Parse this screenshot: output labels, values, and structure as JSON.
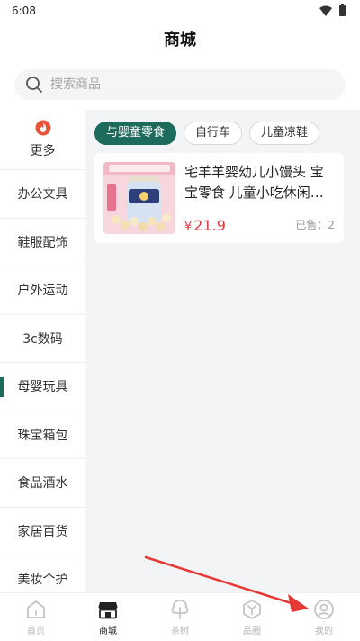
{
  "status_bar": {
    "time": "6:08"
  },
  "header": {
    "title": "商城"
  },
  "search": {
    "placeholder": "搜索商品"
  },
  "sidebar": {
    "items": [
      {
        "label": "更多",
        "icon": "fire-icon"
      },
      {
        "label": "办公文具"
      },
      {
        "label": "鞋服配饰"
      },
      {
        "label": "户外运动"
      },
      {
        "label": "3c数码"
      },
      {
        "label": "母婴玩具",
        "active": true
      },
      {
        "label": "珠宝箱包"
      },
      {
        "label": "食品酒水"
      },
      {
        "label": "家居百货"
      },
      {
        "label": "美妆个护"
      }
    ]
  },
  "subtabs": [
    {
      "label": "与婴童零食",
      "active": true
    },
    {
      "label": "自行车"
    },
    {
      "label": "儿童凉鞋"
    }
  ],
  "products": [
    {
      "title": "宅羊羊婴幼儿小馒头 宝宝零食 儿童小吃休闲…",
      "price_symbol": "¥",
      "price": "21.9",
      "sold": "已售：2"
    }
  ],
  "tabbar": {
    "items": [
      {
        "label": "首页",
        "icon": "home-icon"
      },
      {
        "label": "商城",
        "icon": "shop-icon",
        "active": true
      },
      {
        "label": "茶树",
        "icon": "tree-icon"
      },
      {
        "label": "品圈",
        "icon": "circle-icon"
      },
      {
        "label": "我的",
        "icon": "profile-icon"
      }
    ]
  },
  "colors": {
    "accent": "#1c6b5c",
    "price": "#e0383e",
    "annotation_arrow": "#e53935"
  }
}
